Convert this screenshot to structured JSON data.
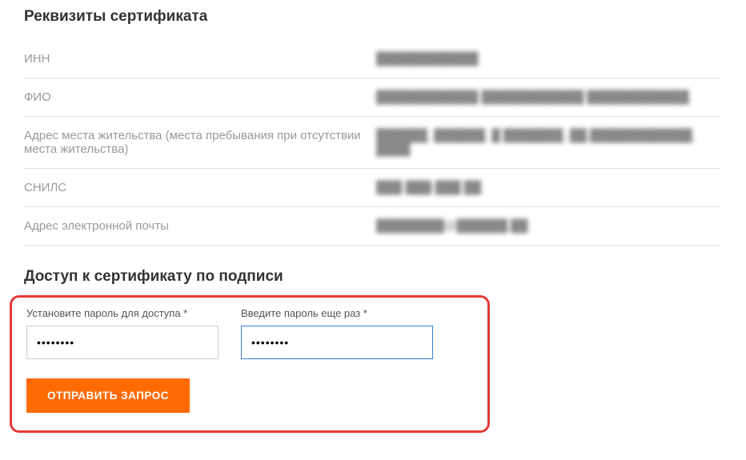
{
  "certificate": {
    "title": "Реквизиты сертификата",
    "rows": {
      "inn": {
        "label": "ИНН",
        "value": "████████████"
      },
      "fio": {
        "label": "ФИО",
        "value": "████████████ ████████████ ████████████"
      },
      "address": {
        "label": "Адрес места жительства (места пребывания при отсутствии места жительства)",
        "value": "██████, ██████, █ ███████, ██.████████████, ████"
      },
      "snils": {
        "label": "СНИЛС",
        "value": "███-███-███ ██"
      },
      "email": {
        "label": "Адрес электронной почты",
        "value": "████████@██████.██"
      }
    }
  },
  "access": {
    "title": "Доступ к сертификату по подписи",
    "password1_label": "Установите пароль для доступа *",
    "password2_label": "Введите пароль еще раз *",
    "password1_value": "••••••••",
    "password2_value": "••••••••",
    "submit_label": "ОТПРАВИТЬ ЗАПРОС"
  }
}
